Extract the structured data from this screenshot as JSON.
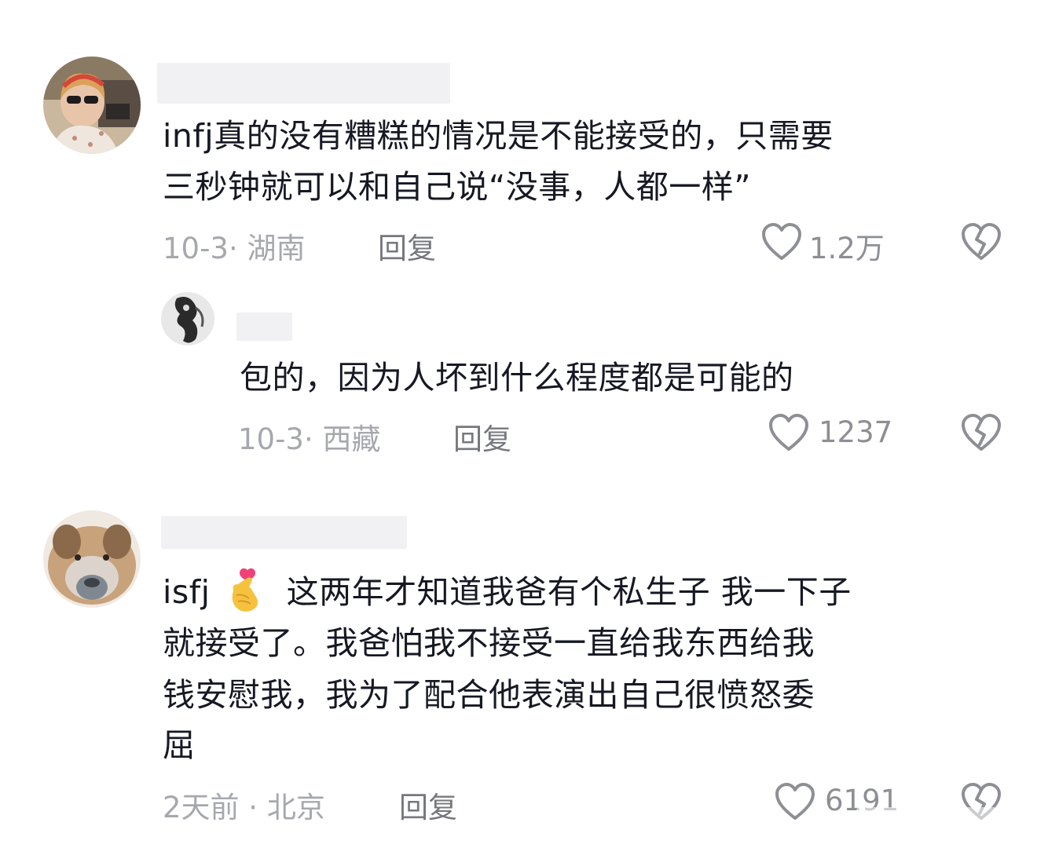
{
  "comments": [
    {
      "text_lines": [
        "infj真的没有糟糕的情况是不能接受的，只需要",
        "三秒钟就可以和自己说“没事，人都一样”"
      ],
      "meta": "10-3· 湖南",
      "reply_label": "回复",
      "like_count": "1.2万",
      "replies": [
        {
          "text_lines": [
            "包的，因为人坏到什么程度都是可能的"
          ],
          "meta": "10-3· 西藏",
          "reply_label": "回复",
          "like_count": "1237"
        }
      ]
    },
    {
      "text_prefix": "isfj",
      "emoji": "🫰",
      "text_lines": [
        "这两年才知道我爸有个私生子 我一下子",
        "就接受了。我爸怕我不接受一直给我东西给我",
        "钱安慰我，我为了配合他表演出自己很愤怒委",
        "屈"
      ],
      "meta": "2天前 · 北京",
      "reply_label": "回复",
      "like_count": "6191"
    }
  ],
  "icons": {
    "like": "heart-outline-icon",
    "dislike": "broken-heart-icon"
  },
  "colors": {
    "text": "#161823",
    "meta": "#a6a8ae",
    "reply": "#76787e",
    "icon": "#8d8f95",
    "redaction": "#f1f1f3"
  }
}
